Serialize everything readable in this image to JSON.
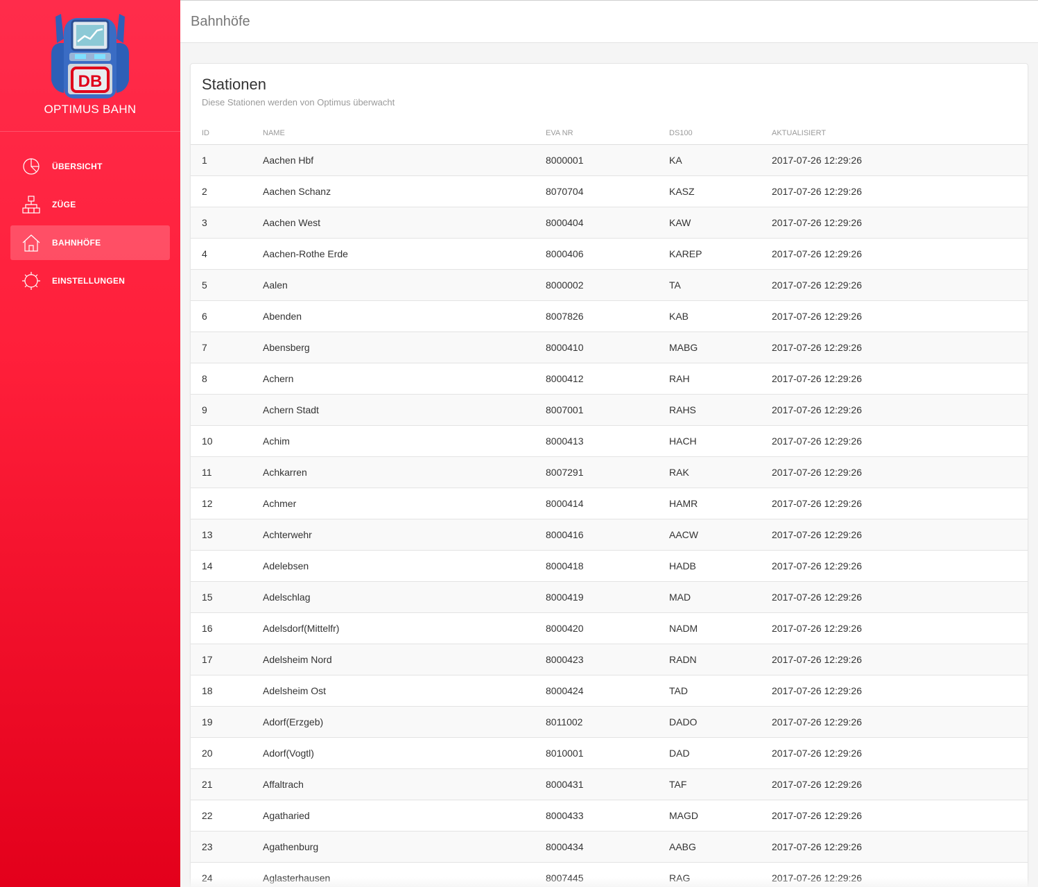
{
  "app": {
    "name": "OPTIMUS BAHN",
    "logo_badge": "DB"
  },
  "colors": {
    "sidebar_top": "#ff2c4b",
    "sidebar_bottom": "#e3001b",
    "accent": "#ff1f3a"
  },
  "sidebar": {
    "items": [
      {
        "label": "ÜBERSICHT",
        "icon": "pie-chart-icon",
        "active": false
      },
      {
        "label": "ZÜGE",
        "icon": "network-icon",
        "active": false
      },
      {
        "label": "BAHNHÖFE",
        "icon": "home-icon",
        "active": true
      },
      {
        "label": "EINSTELLUNGEN",
        "icon": "gear-icon",
        "active": false
      }
    ]
  },
  "header": {
    "title": "Bahnhöfe"
  },
  "card": {
    "title": "Stationen",
    "subtitle": "Diese Stationen werden von Optimus überwacht",
    "columns": [
      "ID",
      "NAME",
      "EVA NR",
      "DS100",
      "AKTUALISIERT"
    ],
    "rows": [
      [
        "1",
        "Aachen Hbf",
        "8000001",
        "KA",
        "2017-07-26 12:29:26"
      ],
      [
        "2",
        "Aachen Schanz",
        "8070704",
        "KASZ",
        "2017-07-26 12:29:26"
      ],
      [
        "3",
        "Aachen West",
        "8000404",
        "KAW",
        "2017-07-26 12:29:26"
      ],
      [
        "4",
        "Aachen-Rothe Erde",
        "8000406",
        "KAREP",
        "2017-07-26 12:29:26"
      ],
      [
        "5",
        "Aalen",
        "8000002",
        "TA",
        "2017-07-26 12:29:26"
      ],
      [
        "6",
        "Abenden",
        "8007826",
        "KAB",
        "2017-07-26 12:29:26"
      ],
      [
        "7",
        "Abensberg",
        "8000410",
        "MABG",
        "2017-07-26 12:29:26"
      ],
      [
        "8",
        "Achern",
        "8000412",
        "RAH",
        "2017-07-26 12:29:26"
      ],
      [
        "9",
        "Achern Stadt",
        "8007001",
        "RAHS",
        "2017-07-26 12:29:26"
      ],
      [
        "10",
        "Achim",
        "8000413",
        "HACH",
        "2017-07-26 12:29:26"
      ],
      [
        "11",
        "Achkarren",
        "8007291",
        "RAK",
        "2017-07-26 12:29:26"
      ],
      [
        "12",
        "Achmer",
        "8000414",
        "HAMR",
        "2017-07-26 12:29:26"
      ],
      [
        "13",
        "Achterwehr",
        "8000416",
        "AACW",
        "2017-07-26 12:29:26"
      ],
      [
        "14",
        "Adelebsen",
        "8000418",
        "HADB",
        "2017-07-26 12:29:26"
      ],
      [
        "15",
        "Adelschlag",
        "8000419",
        "MAD",
        "2017-07-26 12:29:26"
      ],
      [
        "16",
        "Adelsdorf(Mittelfr)",
        "8000420",
        "NADM",
        "2017-07-26 12:29:26"
      ],
      [
        "17",
        "Adelsheim Nord",
        "8000423",
        "RADN",
        "2017-07-26 12:29:26"
      ],
      [
        "18",
        "Adelsheim Ost",
        "8000424",
        "TAD",
        "2017-07-26 12:29:26"
      ],
      [
        "19",
        "Adorf(Erzgeb)",
        "8011002",
        "DADO",
        "2017-07-26 12:29:26"
      ],
      [
        "20",
        "Adorf(Vogtl)",
        "8010001",
        "DAD",
        "2017-07-26 12:29:26"
      ],
      [
        "21",
        "Affaltrach",
        "8000431",
        "TAF",
        "2017-07-26 12:29:26"
      ],
      [
        "22",
        "Agatharied",
        "8000433",
        "MAGD",
        "2017-07-26 12:29:26"
      ],
      [
        "23",
        "Agathenburg",
        "8000434",
        "AABG",
        "2017-07-26 12:29:26"
      ],
      [
        "24",
        "Aglasterhausen",
        "8007445",
        "RAG",
        "2017-07-26 12:29:26"
      ]
    ]
  }
}
